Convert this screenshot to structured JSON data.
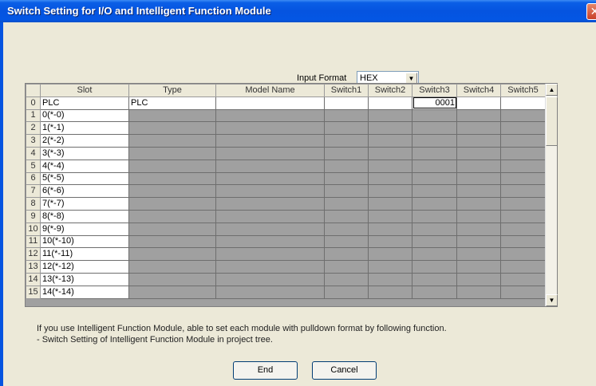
{
  "window": {
    "title": "Switch Setting for I/O and Intelligent Function Module",
    "close_glyph": "✕"
  },
  "input_format": {
    "label": "Input Format",
    "value": "HEX",
    "arrow": "▼"
  },
  "grid": {
    "columns": [
      "",
      "Slot",
      "Type",
      "Model Name",
      "Switch1",
      "Switch2",
      "Switch3",
      "Switch4",
      "Switch5"
    ],
    "rows": [
      {
        "num": "0",
        "slot": "PLC",
        "type": "PLC",
        "model": "",
        "s1": "",
        "s2": "",
        "s3": "0001",
        "s4": "",
        "s5": ""
      },
      {
        "num": "1",
        "slot": "0(*-0)",
        "type": "",
        "model": "",
        "s1": "",
        "s2": "",
        "s3": "",
        "s4": "",
        "s5": ""
      },
      {
        "num": "2",
        "slot": "1(*-1)",
        "type": "",
        "model": "",
        "s1": "",
        "s2": "",
        "s3": "",
        "s4": "",
        "s5": ""
      },
      {
        "num": "3",
        "slot": "2(*-2)",
        "type": "",
        "model": "",
        "s1": "",
        "s2": "",
        "s3": "",
        "s4": "",
        "s5": ""
      },
      {
        "num": "4",
        "slot": "3(*-3)",
        "type": "",
        "model": "",
        "s1": "",
        "s2": "",
        "s3": "",
        "s4": "",
        "s5": ""
      },
      {
        "num": "5",
        "slot": "4(*-4)",
        "type": "",
        "model": "",
        "s1": "",
        "s2": "",
        "s3": "",
        "s4": "",
        "s5": ""
      },
      {
        "num": "6",
        "slot": "5(*-5)",
        "type": "",
        "model": "",
        "s1": "",
        "s2": "",
        "s3": "",
        "s4": "",
        "s5": ""
      },
      {
        "num": "7",
        "slot": "6(*-6)",
        "type": "",
        "model": "",
        "s1": "",
        "s2": "",
        "s3": "",
        "s4": "",
        "s5": ""
      },
      {
        "num": "8",
        "slot": "7(*-7)",
        "type": "",
        "model": "",
        "s1": "",
        "s2": "",
        "s3": "",
        "s4": "",
        "s5": ""
      },
      {
        "num": "9",
        "slot": "8(*-8)",
        "type": "",
        "model": "",
        "s1": "",
        "s2": "",
        "s3": "",
        "s4": "",
        "s5": ""
      },
      {
        "num": "10",
        "slot": "9(*-9)",
        "type": "",
        "model": "",
        "s1": "",
        "s2": "",
        "s3": "",
        "s4": "",
        "s5": ""
      },
      {
        "num": "11",
        "slot": "10(*-10)",
        "type": "",
        "model": "",
        "s1": "",
        "s2": "",
        "s3": "",
        "s4": "",
        "s5": ""
      },
      {
        "num": "12",
        "slot": "11(*-11)",
        "type": "",
        "model": "",
        "s1": "",
        "s2": "",
        "s3": "",
        "s4": "",
        "s5": ""
      },
      {
        "num": "13",
        "slot": "12(*-12)",
        "type": "",
        "model": "",
        "s1": "",
        "s2": "",
        "s3": "",
        "s4": "",
        "s5": ""
      },
      {
        "num": "14",
        "slot": "13(*-13)",
        "type": "",
        "model": "",
        "s1": "",
        "s2": "",
        "s3": "",
        "s4": "",
        "s5": ""
      },
      {
        "num": "15",
        "slot": "14(*-14)",
        "type": "",
        "model": "",
        "s1": "",
        "s2": "",
        "s3": "",
        "s4": "",
        "s5": ""
      }
    ],
    "scroll_up": "▲",
    "scroll_down": "▼"
  },
  "info": {
    "line1": "If you use Intelligent Function Module, able to set each module with pulldown format by following function.",
    "line2": "- Switch Setting of Intelligent Function Module in project tree."
  },
  "buttons": {
    "end": "End",
    "cancel": "Cancel"
  },
  "colors": {
    "titlebar": "#0554e0",
    "dialog_bg": "#ece9d8",
    "disabled_cell": "#a0a0a0"
  }
}
